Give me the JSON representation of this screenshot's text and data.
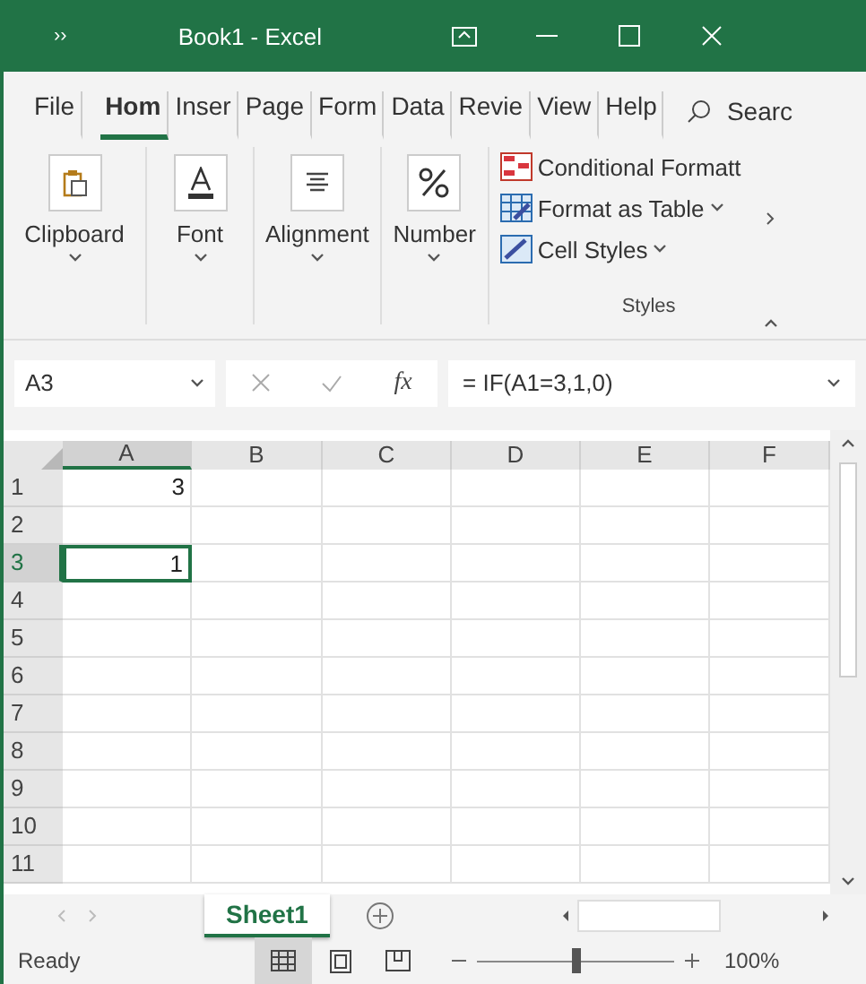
{
  "title_bar": {
    "quick_access": "››",
    "title": "Book1  -  Excel"
  },
  "ribbon_tabs": [
    {
      "label": "File",
      "selected": false
    },
    {
      "label": "Hom",
      "selected": true
    },
    {
      "label": "Inser",
      "selected": false
    },
    {
      "label": "Page",
      "selected": false
    },
    {
      "label": "Form",
      "selected": false
    },
    {
      "label": "Data",
      "selected": false
    },
    {
      "label": "Revie",
      "selected": false
    },
    {
      "label": "View",
      "selected": false
    },
    {
      "label": "Help",
      "selected": false
    }
  ],
  "search": {
    "label": "Searc"
  },
  "ribbon_groups": [
    {
      "kind": "clipboard",
      "label": "Clipboard"
    },
    {
      "kind": "font",
      "label": "Font"
    },
    {
      "kind": "alignment",
      "label": "Alignment"
    },
    {
      "kind": "number",
      "label": "Number"
    }
  ],
  "styles_group": {
    "label": "Styles",
    "items": [
      {
        "kind": "conditional",
        "label": "Conditional Formatt",
        "dropdown": false
      },
      {
        "kind": "table",
        "label": "Format as Table",
        "dropdown": true
      },
      {
        "kind": "cellstyles",
        "label": "Cell Styles",
        "dropdown": true
      }
    ]
  },
  "formula_bar": {
    "name_box": "A3",
    "fx": "fx",
    "formula": "= IF(A1=3,1,0)"
  },
  "columns": [
    {
      "label": "A",
      "selected": true
    },
    {
      "label": "B",
      "selected": false
    },
    {
      "label": "C",
      "selected": false
    },
    {
      "label": "D",
      "selected": false
    },
    {
      "label": "E",
      "selected": false
    },
    {
      "label": "F",
      "selected": false
    }
  ],
  "rows": [
    {
      "number": "1",
      "selected": false,
      "cells": [
        "3",
        "",
        "",
        "",
        "",
        ""
      ]
    },
    {
      "number": "2",
      "selected": false,
      "cells": [
        "",
        "",
        "",
        "",
        "",
        ""
      ]
    },
    {
      "number": "3",
      "selected": true,
      "cells": [
        "1",
        "",
        "",
        "",
        "",
        ""
      ]
    },
    {
      "number": "4",
      "selected": false,
      "cells": [
        "",
        "",
        "",
        "",
        "",
        ""
      ]
    },
    {
      "number": "5",
      "selected": false,
      "cells": [
        "",
        "",
        "",
        "",
        "",
        ""
      ]
    },
    {
      "number": "6",
      "selected": false,
      "cells": [
        "",
        "",
        "",
        "",
        "",
        ""
      ]
    },
    {
      "number": "7",
      "selected": false,
      "cells": [
        "",
        "",
        "",
        "",
        "",
        ""
      ]
    },
    {
      "number": "8",
      "selected": false,
      "cells": [
        "",
        "",
        "",
        "",
        "",
        ""
      ]
    },
    {
      "number": "9",
      "selected": false,
      "cells": [
        "",
        "",
        "",
        "",
        "",
        ""
      ]
    },
    {
      "number": "10",
      "selected": false,
      "cells": [
        "",
        "",
        "",
        "",
        "",
        ""
      ]
    },
    {
      "number": "11",
      "selected": false,
      "cells": [
        "",
        "",
        "",
        "",
        "",
        ""
      ]
    }
  ],
  "sheet_tabs": [
    {
      "label": "Sheet1",
      "selected": true
    }
  ],
  "status_bar": {
    "status": "Ready",
    "views": [
      {
        "kind": "normal",
        "selected": true
      },
      {
        "kind": "page_layout",
        "selected": false
      },
      {
        "kind": "page_break",
        "selected": false
      }
    ],
    "zoom": {
      "level": 0.5,
      "reading": "100%"
    }
  }
}
